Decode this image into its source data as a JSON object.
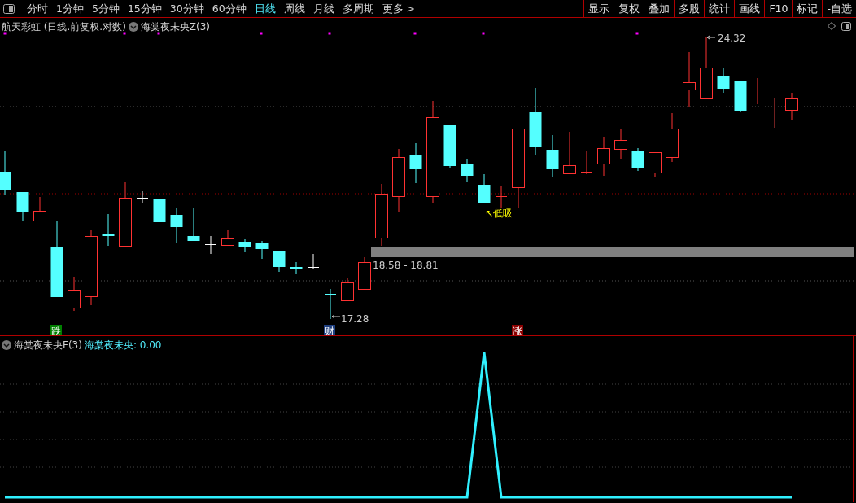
{
  "toolbar": {
    "periods": [
      {
        "label": "分时",
        "selected": false
      },
      {
        "label": "1分钟",
        "selected": false
      },
      {
        "label": "5分钟",
        "selected": false
      },
      {
        "label": "15分钟",
        "selected": false
      },
      {
        "label": "30分钟",
        "selected": false
      },
      {
        "label": "60分钟",
        "selected": false
      },
      {
        "label": "日线",
        "selected": true
      },
      {
        "label": "周线",
        "selected": false
      },
      {
        "label": "月线",
        "selected": false
      },
      {
        "label": "多周期",
        "selected": false
      },
      {
        "label": "更多 >",
        "selected": false
      }
    ],
    "tools": [
      "显示",
      "复权",
      "叠加",
      "多股",
      "统计",
      "画线",
      "F10",
      "标记",
      "-自选"
    ]
  },
  "main_chart": {
    "title": "航天彩虹 (日线.前复权.对数)",
    "indicator": "海棠夜未央Z(3)",
    "high_label": "24.32",
    "low_label": "17.28",
    "range_label": "18.58 - 18.81",
    "signal_label": "↖低吸",
    "markers": [
      {
        "text": "跌",
        "color": "#008000"
      },
      {
        "text": "财",
        "color": "#1f3f7f"
      },
      {
        "text": "涨",
        "color": "#8b0000"
      }
    ]
  },
  "sub_chart": {
    "indicator": "海棠夜未央F(3)",
    "reading": "海棠夜未央: 0.00"
  }
}
